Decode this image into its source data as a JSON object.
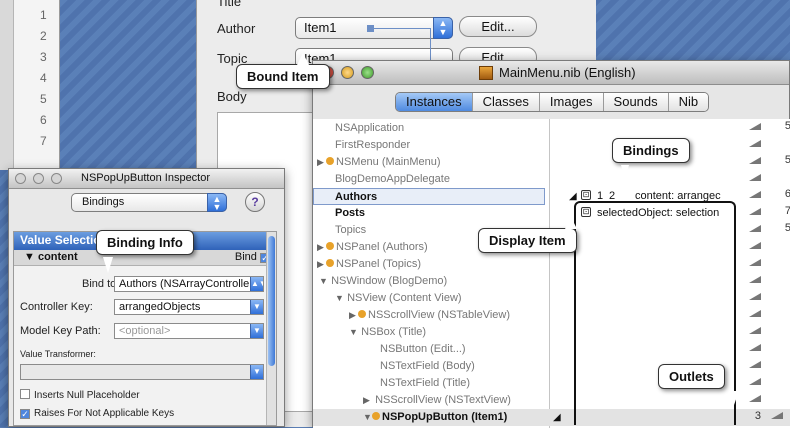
{
  "strip": {
    "numbers": [
      "1",
      "2",
      "3",
      "4",
      "5",
      "6",
      "7"
    ]
  },
  "editor": {
    "title_label": "Title",
    "author_label": "Author",
    "author_popup": "Item1",
    "topic_label": "Topic",
    "topic_popup": "Item1",
    "body_label": "Body",
    "edit_button": "Edit...",
    "edit_button2": "Edit..."
  },
  "nib_window": {
    "title": "MainMenu.nib (English)",
    "tabs": [
      "Instances",
      "Classes",
      "Images",
      "Sounds",
      "Nib"
    ],
    "active_tab": "Instances",
    "rows": [
      {
        "label": "NSApplication",
        "style": "gray"
      },
      {
        "label": "FirstResponder",
        "style": "gray"
      },
      {
        "label": "NSMenu (MainMenu)",
        "style": "gray"
      },
      {
        "label": "BlogDemoAppDelegate",
        "style": "gray"
      },
      {
        "label": "Authors",
        "style": "dark"
      },
      {
        "label": "Posts",
        "style": "dark"
      },
      {
        "label": "Topics",
        "style": "gray"
      },
      {
        "label": "NSPanel (Authors)",
        "style": "gray"
      },
      {
        "label": "NSPanel (Topics)",
        "style": "gray"
      },
      {
        "label": "NSWindow (BlogDemo)",
        "style": "gray"
      },
      {
        "label": "NSView (Content View)",
        "style": "gray"
      },
      {
        "label": "NSScrollView (NSTableView)",
        "style": "gray"
      },
      {
        "label": "NSBox (Title)",
        "style": "gray"
      },
      {
        "label": "NSButton (Edit...)",
        "style": "gray"
      },
      {
        "label": "NSTextField (Body)",
        "style": "gray"
      },
      {
        "label": "NSTextField (Title)",
        "style": "gray"
      },
      {
        "label": "NSScrollView (NSTextView)",
        "style": "gray"
      },
      {
        "label": "NSPopUpButton (Item1)",
        "style": "dark"
      }
    ],
    "binding_count": "1",
    "binding_index": "2",
    "binding_content": "content: arrangec",
    "binding_selected": "selectedObject: selection",
    "outlet_numbers": [
      "5",
      "",
      "5",
      "6",
      "7",
      "5"
    ],
    "bottom_outlet": "3"
  },
  "inspector": {
    "title": "NSPopUpButton Inspector",
    "mode": "Bindings",
    "help": "?",
    "section_header": "Value Selection",
    "subsection": "content",
    "bind_label": "Bind",
    "bind_to_label": "Bind to:",
    "bind_to_value": "Authors (NSArrayController)",
    "controller_key_label": "Controller Key:",
    "controller_key_value": "arrangedObjects",
    "model_key_path_label": "Model Key Path:",
    "model_key_path_placeholder": "<optional>",
    "value_transformer_label": "Value Transformer:",
    "inserts_null": "Inserts Null Placeholder",
    "raises_na": "Raises For Not Applicable Keys"
  },
  "callouts": {
    "bound_item": "Bound Item",
    "bindings": "Bindings",
    "display_item": "Display Item",
    "binding_info": "Binding Info",
    "outlets": "Outlets"
  }
}
